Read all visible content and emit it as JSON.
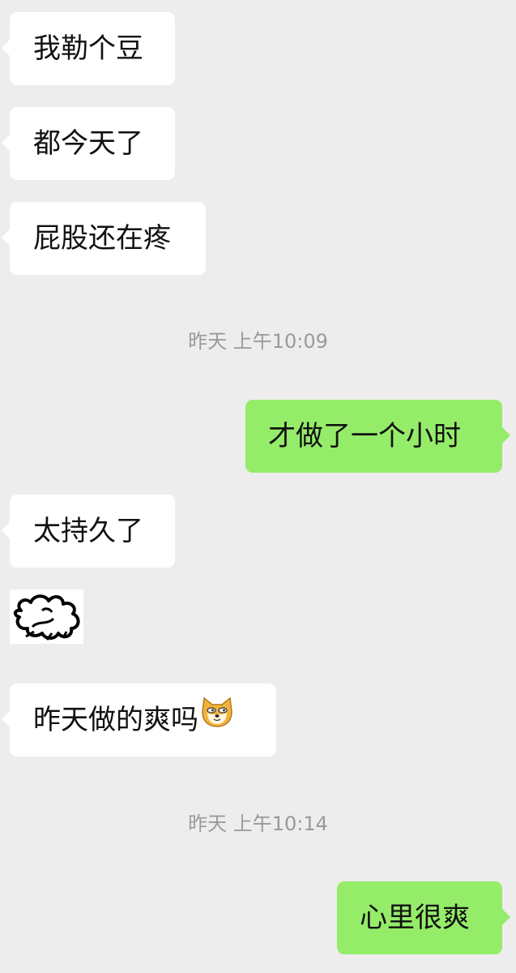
{
  "messages": [
    {
      "side": "in",
      "text": "我勒个豆"
    },
    {
      "side": "in",
      "text": "都今天了"
    },
    {
      "side": "in",
      "text": "屁股还在疼"
    },
    {
      "type": "timestamp",
      "text": "昨天 上午10:09"
    },
    {
      "side": "out",
      "text": "才做了一个小时"
    },
    {
      "side": "in",
      "text": "太持久了"
    },
    {
      "side": "in",
      "type": "sticker",
      "icon": "scribble-cloud-sticker"
    },
    {
      "side": "in",
      "text": "昨天做的爽吗",
      "icon": "doge-emoji"
    },
    {
      "type": "timestamp",
      "text": "昨天 上午10:14"
    },
    {
      "side": "out",
      "text": "心里很爽"
    }
  ],
  "colors": {
    "background": "#ededed",
    "incoming_bubble": "#ffffff",
    "outgoing_bubble": "#95ec69",
    "timestamp_text": "#9a9a9a"
  }
}
